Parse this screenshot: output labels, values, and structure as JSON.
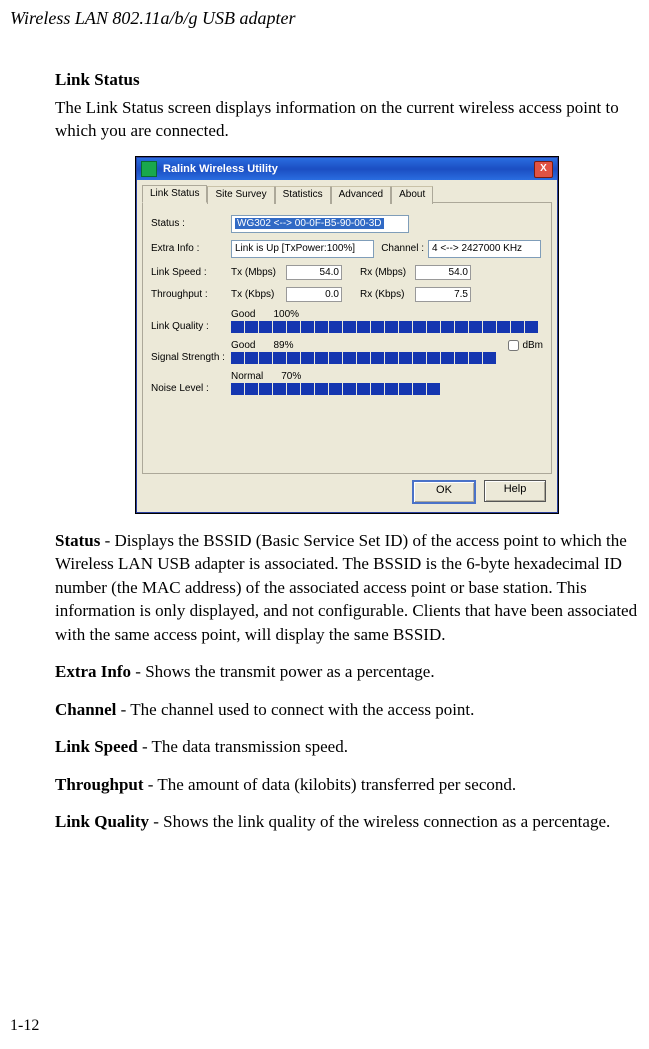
{
  "header": "Wireless LAN 802.11a/b/g USB adapter",
  "section_title": "Link Status",
  "intro_text": "The Link Status screen displays information on the current wireless access point to which you are connected.",
  "window": {
    "title": "Ralink Wireless Utility",
    "close_glyph": "X",
    "tabs": [
      "Link Status",
      "Site Survey",
      "Statistics",
      "Advanced",
      "About"
    ],
    "fields": {
      "status_label": "Status :",
      "status_value": "WG302 <--> 00-0F-B5-90-00-3D",
      "extra_info_label": "Extra Info :",
      "extra_info_value": "Link is Up [TxPower:100%]",
      "channel_label": "Channel :",
      "channel_value": "4 <--> 2427000 KHz",
      "link_speed_label": "Link Speed :",
      "tx_mbps_label": "Tx (Mbps)",
      "tx_mbps_value": "54.0",
      "rx_mbps_label": "Rx (Mbps)",
      "rx_mbps_value": "54.0",
      "throughput_label": "Throughput :",
      "tx_kbps_label": "Tx (Kbps)",
      "tx_kbps_value": "0.0",
      "rx_kbps_label": "Rx (Kbps)",
      "rx_kbps_value": "7.5",
      "link_quality_label": "Link Quality :",
      "link_quality_status": "Good",
      "link_quality_pct": "100%",
      "signal_strength_label": "Signal Strength :",
      "signal_strength_status": "Good",
      "signal_strength_pct": "89%",
      "dbm_label": "dBm",
      "noise_level_label": "Noise Level :",
      "noise_status": "Normal",
      "noise_pct": "70%"
    },
    "buttons": {
      "ok": "OK",
      "help": "Help"
    }
  },
  "defs": {
    "status_title": "Status",
    "status_body": " - Displays the BSSID (Basic Service Set ID) of the access point to which the Wireless LAN USB adapter is associated. The BSSID is the 6-byte hexadecimal ID number (the MAC address) of the associated access point or base station. This information is only displayed, and not configurable. Clients that have been associated with the same access point, will display the same BSSID.",
    "extra_title": "Extra Info",
    "extra_body": " - Shows the transmit power as a percentage.",
    "channel_title": "Channel",
    "channel_body": " - The channel used to connect with the access point.",
    "speed_title": "Link Speed",
    "speed_body": " - The data transmission speed.",
    "throughput_title": "Throughput",
    "throughput_body": " - The amount of data (kilobits) transferred per second.",
    "lq_title": "Link Quality",
    "lq_body": " - Shows the link quality of the wireless connection as a percentage."
  },
  "page_num": "1-12"
}
